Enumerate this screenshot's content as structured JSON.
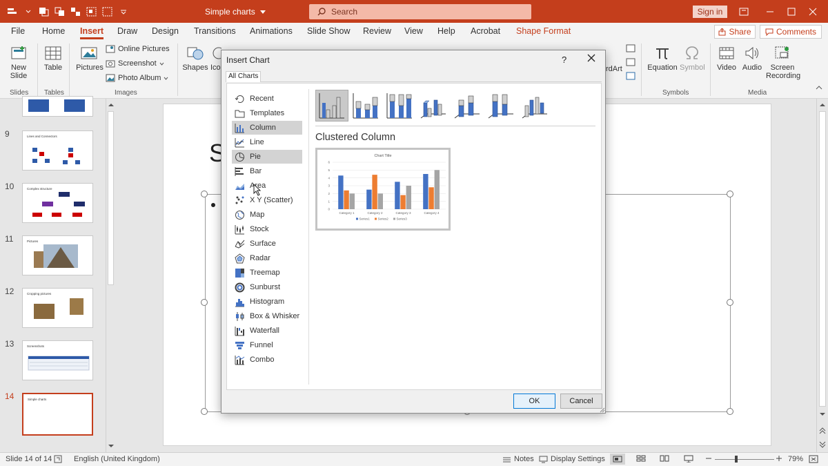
{
  "window": {
    "doc_title": "Simple charts",
    "search_placeholder": "Search",
    "signin": "Sign in"
  },
  "tabs": [
    "File",
    "Home",
    "Insert",
    "Draw",
    "Design",
    "Transitions",
    "Animations",
    "Slide Show",
    "Review",
    "View",
    "Help",
    "Acrobat",
    "Shape Format"
  ],
  "active_tab": "Insert",
  "share": "Share",
  "comments": "Comments",
  "ribbon": {
    "new_slide": "New",
    "new_slide_2": "Slide",
    "table": "Table",
    "pictures": "Pictures",
    "online_pictures": "Online Pictures",
    "screenshot": "Screenshot",
    "photo_album": "Photo Album",
    "shapes": "Shapes",
    "icons": "Ico",
    "wordart": "rdArt",
    "equation": "Equation",
    "symbol": "Symbol",
    "video": "Video",
    "audio": "Audio",
    "screen_recording": "Screen",
    "screen_recording_2": "Recording",
    "groups": {
      "slides": "Slides",
      "tables": "Tables",
      "images": "Images",
      "symbols": "Symbols",
      "media": "Media"
    }
  },
  "slides": [
    {
      "num": "9",
      "title": "Lines and Connectors"
    },
    {
      "num": "10",
      "title": "Complex structure"
    },
    {
      "num": "11",
      "title": "Pictures"
    },
    {
      "num": "12",
      "title": "Cropping pictures"
    },
    {
      "num": "13",
      "title": "Screenshots"
    },
    {
      "num": "14",
      "title": "Simple charts"
    }
  ],
  "slide_title_fragment": "S",
  "status": {
    "slide_pos": "Slide 14 of 14",
    "language": "English (United Kingdom)",
    "notes": "Notes",
    "display_settings": "Display Settings",
    "zoom": "79%"
  },
  "dialog": {
    "title": "Insert Chart",
    "help": "?",
    "tab": "All Charts",
    "categories": [
      "Recent",
      "Templates",
      "Column",
      "Line",
      "Pie",
      "Bar",
      "Area",
      "X Y (Scatter)",
      "Map",
      "Stock",
      "Surface",
      "Radar",
      "Treemap",
      "Sunburst",
      "Histogram",
      "Box & Whisker",
      "Waterfall",
      "Funnel",
      "Combo"
    ],
    "selected_category": "Column",
    "hover_category": "Pie",
    "chart_name": "Clustered Column",
    "ok": "OK",
    "cancel": "Cancel"
  },
  "chart_data": {
    "type": "bar",
    "title": "Chart Title",
    "categories": [
      "Category 1",
      "Category 2",
      "Category 3",
      "Category 4"
    ],
    "series": [
      {
        "name": "Series1",
        "values": [
          4.3,
          2.5,
          3.5,
          4.5
        ],
        "color": "#4472c4"
      },
      {
        "name": "Series2",
        "values": [
          2.4,
          4.4,
          1.8,
          2.8
        ],
        "color": "#ed7d31"
      },
      {
        "name": "Series3",
        "values": [
          2,
          2,
          3,
          5
        ],
        "color": "#a5a5a5"
      }
    ],
    "ylim": [
      0,
      6
    ],
    "yticks": [
      0,
      1,
      2,
      3,
      4,
      5,
      6
    ],
    "grid": true,
    "legend": "bottom"
  },
  "colors": {
    "accent": "#c43e1c"
  }
}
